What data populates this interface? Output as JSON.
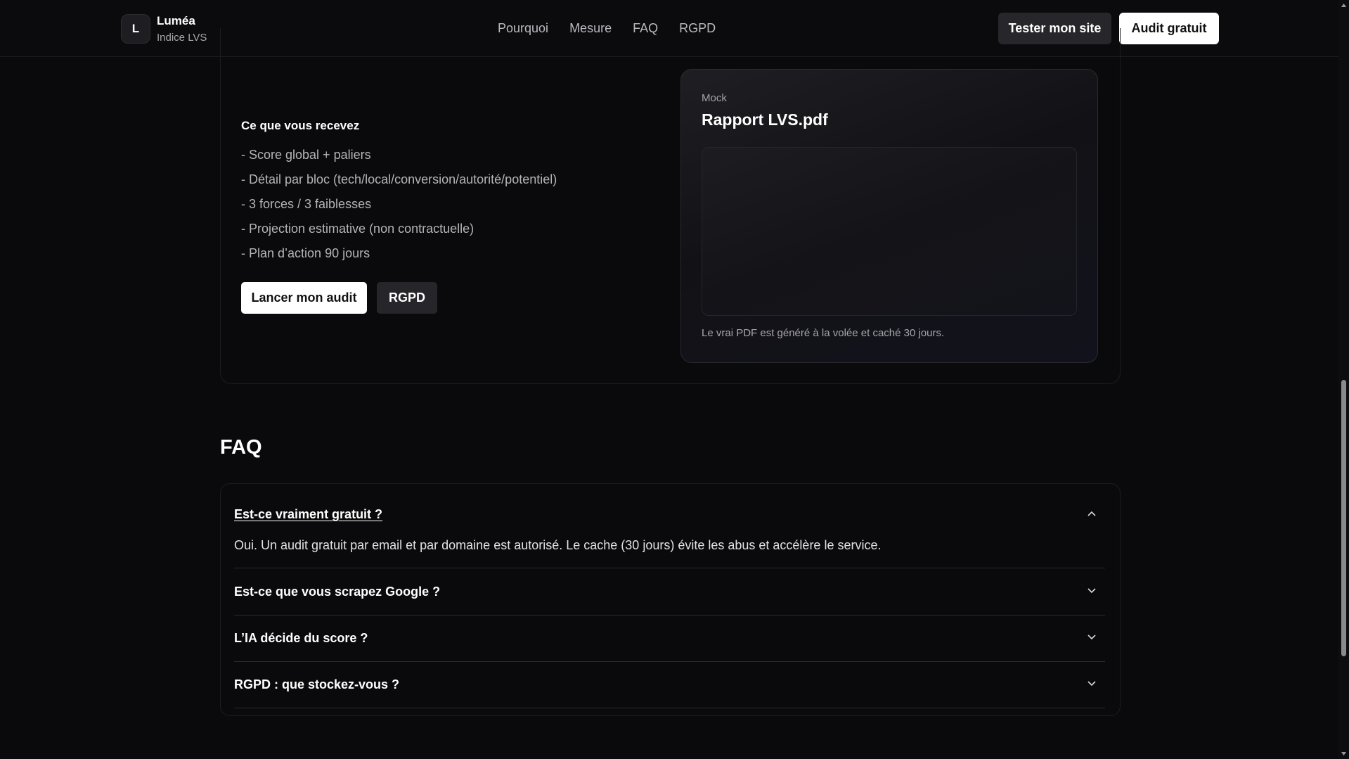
{
  "brand": {
    "logo_letter": "L",
    "name": "Luméa",
    "subtitle": "Indice LVS"
  },
  "nav": {
    "items": [
      "Pourquoi",
      "Mesure",
      "FAQ",
      "RGPD"
    ]
  },
  "header_actions": {
    "test_label": "Tester mon site",
    "audit_label": "Audit gratuit"
  },
  "receive": {
    "title": "Ce que vous recevez",
    "items": [
      "- Score global + paliers",
      "- Détail par bloc (tech/local/conversion/autorité/potentiel)",
      "- 3 forces / 3 faiblesses",
      "- Projection estimative (non contractuelle)",
      "- Plan d’action 90 jours"
    ],
    "launch_label": "Lancer mon audit",
    "rgpd_label": "RGPD"
  },
  "mock": {
    "label": "Mock",
    "title": "Rapport LVS.pdf",
    "note": "Le vrai PDF est généré à la volée et caché 30 jours."
  },
  "faq": {
    "heading": "FAQ",
    "items": [
      {
        "question": "Est-ce vraiment gratuit ?",
        "answer": "Oui. Un audit gratuit par email et par domaine est autorisé. Le cache (30 jours) évite les abus et accélère le service.",
        "open": true
      },
      {
        "question": "Est-ce que vous scrapez Google ?",
        "open": false
      },
      {
        "question": "L’IA décide du score ?",
        "open": false
      },
      {
        "question": "RGPD : que stockez-vous ?",
        "open": false
      }
    ]
  },
  "colors": {
    "background": "#0a0a0c",
    "card_border": "#1d1d21",
    "text_muted": "#b4b4ba",
    "button_light": "#ffffff",
    "button_dark": "#27272b"
  },
  "icons": {
    "chevron_up": "chevron-up-icon",
    "chevron_down": "chevron-down-icon"
  }
}
